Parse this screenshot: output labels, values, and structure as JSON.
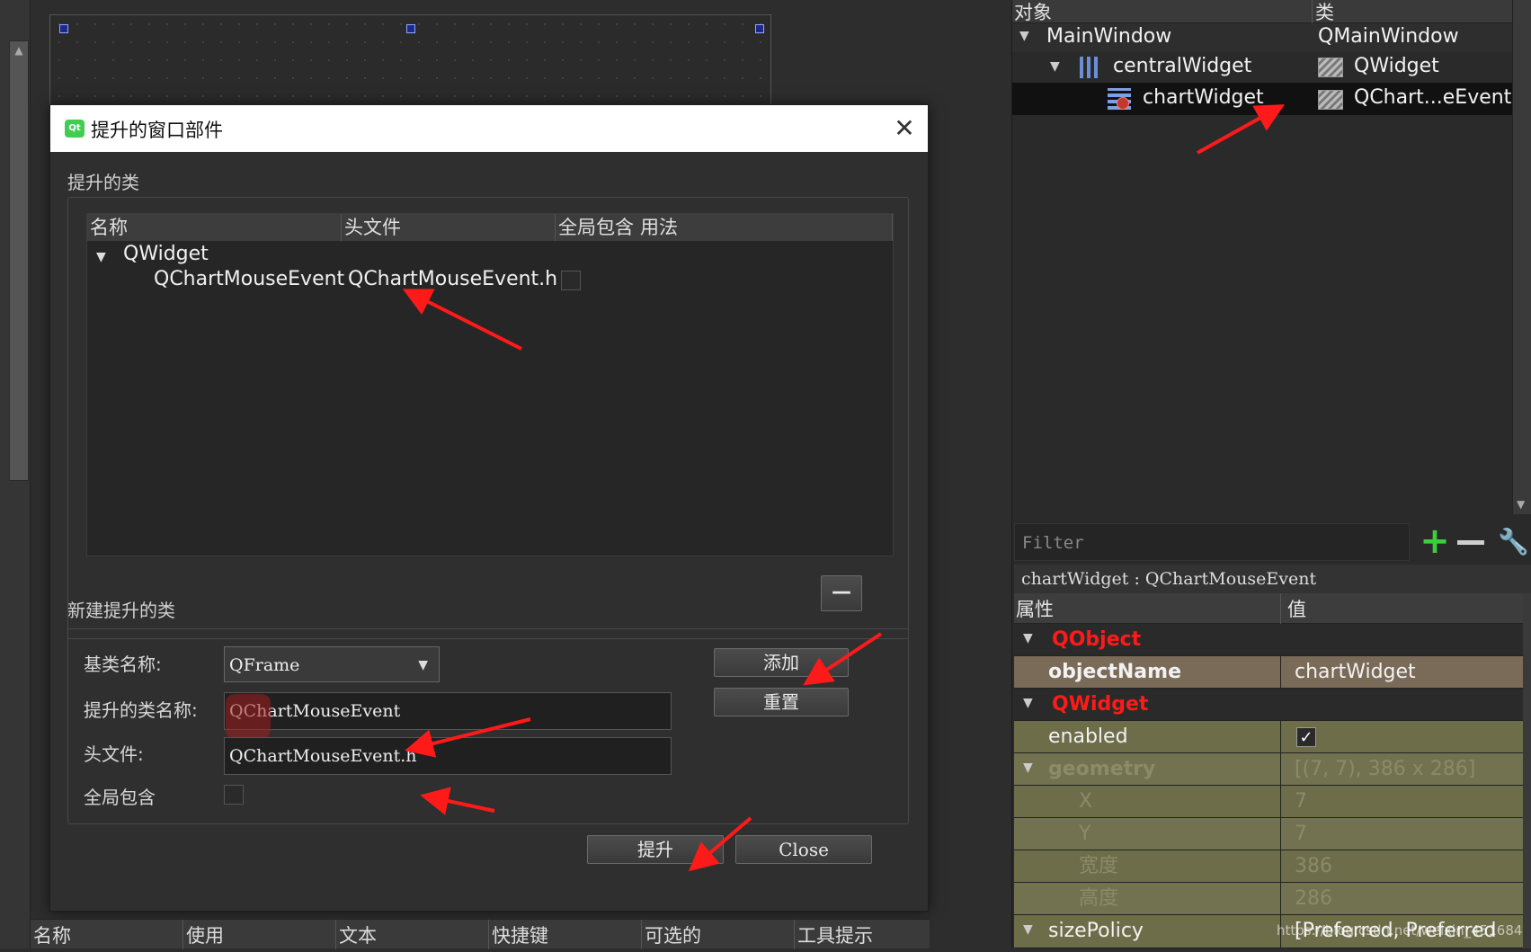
{
  "dialog": {
    "title": "提升的窗口部件",
    "promoted_section": "提升的类",
    "table_headers": [
      "名称",
      "头文件",
      "全局包含",
      "用法"
    ],
    "tree_parent": "QWidget",
    "tree_child_name": "QChartMouseEvent",
    "tree_child_header": "QChartMouseEvent.h",
    "new_section": "新建提升的类",
    "base_class_label": "基类名称:",
    "base_class_value": "QFrame",
    "promoted_name_label": "提升的类名称:",
    "promoted_name_value": "QChartMouseEvent",
    "header_label": "头文件:",
    "header_value": "QChartMouseEvent.h",
    "global_include_label": "全局包含",
    "add_button": "添加",
    "reset_button": "重置",
    "promote_button": "提升",
    "close_button": "Close",
    "remove_button_glyph": "—"
  },
  "bottom_panel": {
    "headers": [
      "名称",
      "使用",
      "文本",
      "快捷键",
      "可选的",
      "工具提示"
    ]
  },
  "object_inspector": {
    "headers": [
      "对象",
      "类"
    ],
    "rows": [
      {
        "name": "MainWindow",
        "class": "QMainWindow"
      },
      {
        "name": "centralWidget",
        "class": "QWidget"
      },
      {
        "name": "chartWidget",
        "class": "QChart...eEvent"
      }
    ]
  },
  "property_editor": {
    "filter_placeholder": "Filter",
    "object_label": "chartWidget : QChartMouseEvent",
    "headers": [
      "属性",
      "值"
    ],
    "rows": [
      {
        "name": "QObject",
        "value": ""
      },
      {
        "name": "objectName",
        "value": "chartWidget"
      },
      {
        "name": "QWidget",
        "value": ""
      },
      {
        "name": "enabled",
        "value": "✓"
      },
      {
        "name": "geometry",
        "value": "[(7, 7), 386 x 286]"
      },
      {
        "name": "X",
        "value": "7"
      },
      {
        "name": "Y",
        "value": "7"
      },
      {
        "name": "宽度",
        "value": "386"
      },
      {
        "name": "高度",
        "value": "286"
      },
      {
        "name": "sizePolicy",
        "value": "[Preferred, Preferred"
      }
    ],
    "watermark": "https://blog.csdn.net/weixin_45168487"
  },
  "colors": {
    "arrow": "#ff1a1a",
    "section_red": "#ff1a1a",
    "selection": "#111111"
  }
}
